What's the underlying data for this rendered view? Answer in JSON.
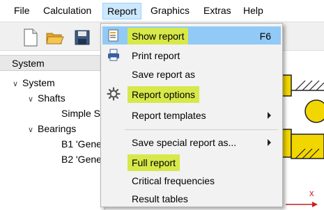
{
  "menubar": {
    "items": [
      "File",
      "Calculation",
      "Report",
      "Graphics",
      "Extras",
      "Help"
    ],
    "active": "Report"
  },
  "toolbar": {
    "icons": [
      "new-document-icon",
      "open-folder-icon",
      "save-icon"
    ]
  },
  "system_panel": {
    "title": "System",
    "tree": [
      {
        "label": "System",
        "expanded": true
      },
      {
        "label": "Shafts",
        "expanded": true,
        "selected": true
      },
      {
        "label": "Simple S"
      },
      {
        "label": "Bearings",
        "expanded": true
      },
      {
        "label": "B1 'Gene"
      },
      {
        "label": "B2 'Gene"
      }
    ]
  },
  "report_menu": {
    "items": [
      {
        "label": "Show report",
        "shortcut": "F6",
        "icon": "report-icon",
        "hover": true,
        "highlighted": true
      },
      {
        "label": "Print report",
        "icon": "printer-icon"
      },
      {
        "label": "Save report as"
      },
      {
        "label": "Report options",
        "icon": "gear-icon",
        "highlighted": true
      },
      {
        "label": "Report templates",
        "submenu": true
      },
      {
        "label": "Save special report as...",
        "submenu": true
      },
      {
        "label": "Full report",
        "highlighted": true
      },
      {
        "label": "Critical frequencies"
      },
      {
        "label": "Result tables"
      }
    ]
  },
  "drawing": {
    "axis_label": "x"
  },
  "colors": {
    "highlight": "#d7e84a",
    "hover": "#91c9f7",
    "bearing_yellow": "#f2d600",
    "axis_red": "#cc1f1f"
  }
}
